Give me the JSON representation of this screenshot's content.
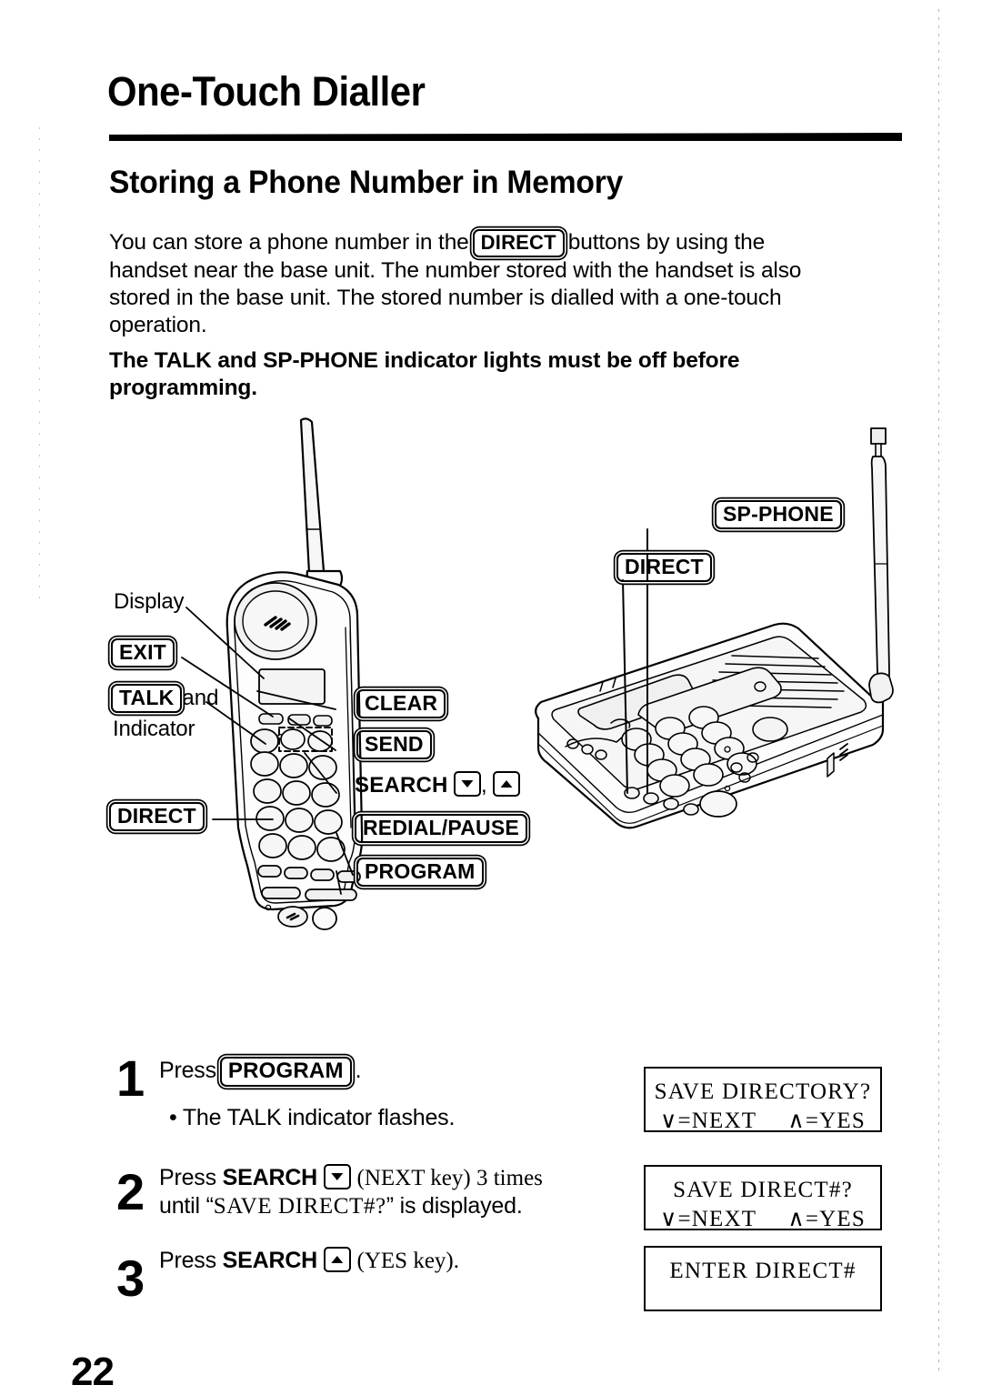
{
  "document": {
    "chapter_title": "One-Touch Dialler",
    "section_title": "Storing a Phone Number in Memory",
    "page_number": "22"
  },
  "intro": {
    "part1": "You can store a phone number in the",
    "key": "DIRECT",
    "part2": "buttons by using the handset near the base unit. The number stored with the handset is also stored in the base unit. The stored number is dialled with a one-touch operation.",
    "bold_note": "The TALK and SP-PHONE indicator lights must be off before programming."
  },
  "diagram": {
    "handset": {
      "display_label": "Display",
      "exit_key": "EXIT",
      "talk_key": "TALK",
      "talk_suffix": "and",
      "indicator_label": "Indicator",
      "direct_key": "DIRECT",
      "clear_key": "CLEAR",
      "send_key": "SEND",
      "search_label": "SEARCH",
      "search_separator": ",",
      "redial_key": "REDIAL/PAUSE",
      "program_key": "PROGRAM"
    },
    "base_unit": {
      "sp_phone_key": "SP-PHONE",
      "direct_key": "DIRECT"
    }
  },
  "steps": [
    {
      "number": "1",
      "text_before": "Press",
      "key": "PROGRAM",
      "text_after": ".",
      "bullet": "• The TALK indicator flashes.",
      "lcd": {
        "line1": "SAVE DIRECTORY?",
        "line2_left": "∨=NEXT",
        "line2_right": "∧=YES"
      }
    },
    {
      "number": "2",
      "text_before": "Press",
      "bold_word": "SEARCH",
      "arrow": "down",
      "paren": "(NEXT key) 3 times",
      "line2_before": "until “",
      "line2_mono": "SAVE DIRECT#?",
      "line2_after": "” is displayed.",
      "lcd": {
        "line1": "SAVE DIRECT#?",
        "line2_left": "∨=NEXT",
        "line2_right": "∧=YES"
      }
    },
    {
      "number": "3",
      "text_before": "Press",
      "bold_word": "SEARCH",
      "arrow": "up",
      "paren": "(YES key).",
      "lcd": {
        "line1": "ENTER DIRECT#",
        "line2_left": "",
        "line2_right": ""
      }
    }
  ]
}
